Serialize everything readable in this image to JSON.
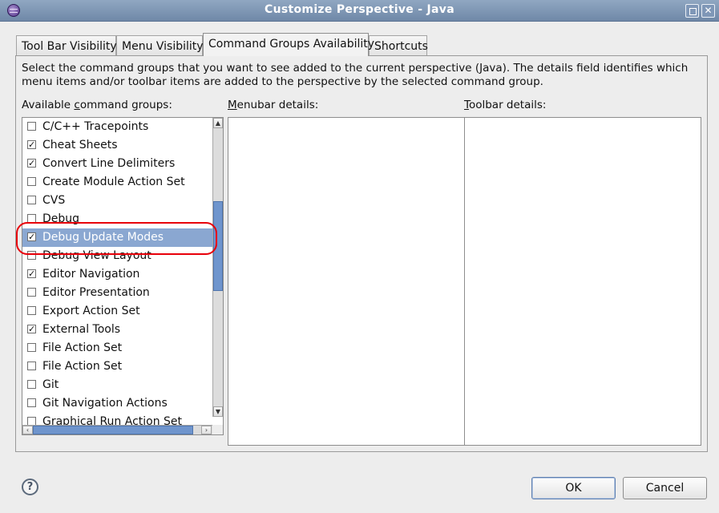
{
  "window": {
    "title": "Customize Perspective - Java",
    "maximize_icon": "maximize-icon",
    "close_icon": "close-icon",
    "close_glyph": "✕"
  },
  "tabs": [
    {
      "label": "Tool Bar Visibility",
      "active": false
    },
    {
      "label": "Menu Visibility",
      "active": false
    },
    {
      "label": "Command Groups Availability",
      "active": true
    },
    {
      "label": "Shortcuts",
      "active": false
    }
  ],
  "panel": {
    "description": "Select the command groups that you want to see added to the current perspective (Java).  The details field identifies which menu items and/or toolbar items are added to the perspective by the selected command group.",
    "available_label_pre": "Available ",
    "available_label_mnemonic": "c",
    "available_label_post": "ommand groups:",
    "menubar_label_mnemonic": "M",
    "menubar_label_post": "enubar details:",
    "toolbar_label_mnemonic": "T",
    "toolbar_label_post": "oolbar details:"
  },
  "command_groups": [
    {
      "label": "C/C++ Tracepoints",
      "checked": false
    },
    {
      "label": "Cheat Sheets",
      "checked": true
    },
    {
      "label": "Convert Line Delimiters",
      "checked": true
    },
    {
      "label": "Create Module Action Set",
      "checked": false
    },
    {
      "label": "CVS",
      "checked": false
    },
    {
      "label": "Debug",
      "checked": false
    },
    {
      "label": "Debug Update Modes",
      "checked": true,
      "selected": true
    },
    {
      "label": "Debug View Layout",
      "checked": false
    },
    {
      "label": "Editor Navigation",
      "checked": true
    },
    {
      "label": "Editor Presentation",
      "checked": false
    },
    {
      "label": "Export Action Set",
      "checked": false
    },
    {
      "label": "External Tools",
      "checked": true
    },
    {
      "label": "File Action Set",
      "checked": false
    },
    {
      "label": "File Action Set",
      "checked": false
    },
    {
      "label": "Git",
      "checked": false
    },
    {
      "label": "Git Navigation Actions",
      "checked": false
    },
    {
      "label": "Graphical Run Action Set",
      "checked": false
    }
  ],
  "checkmark_glyph": "✓",
  "scrollbar": {
    "up_glyph": "▲",
    "down_glyph": "▼",
    "left_glyph": "‹",
    "right_glyph": "›"
  },
  "buttons": {
    "help_glyph": "?",
    "ok": "OK",
    "cancel": "Cancel"
  },
  "colors": {
    "selection": "#8aa7d1",
    "annotation": "#e8000a",
    "titlebar": "#7f97b7"
  }
}
